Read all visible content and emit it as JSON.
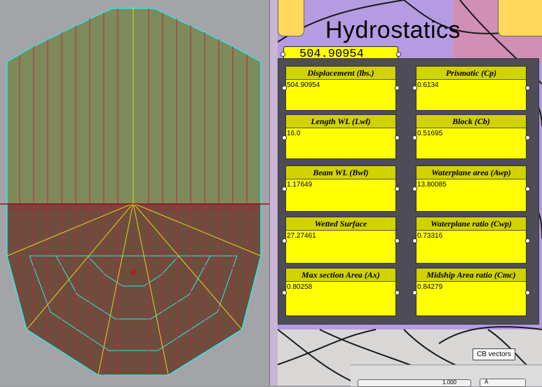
{
  "canvas": {
    "title": "Hydrostatics",
    "main_value": "504.90954"
  },
  "results": [
    {
      "label": "Displacement (lbs.)",
      "value": "504.90954"
    },
    {
      "label": "Prismatic (Cp)",
      "value": "0.6134"
    },
    {
      "label": "Length WL (Lwl)",
      "value": "16.0"
    },
    {
      "label": "Block (Cb)",
      "value": "0.51695"
    },
    {
      "label": "Beam WL (Bwl)",
      "value": "1.17649"
    },
    {
      "label": "Waterplane area (Awp)",
      "value": "13.80085"
    },
    {
      "label": "Wetted Surface",
      "value": "27.27461"
    },
    {
      "label": "Waterplane ratio (Cwp)",
      "value": "0.73316"
    },
    {
      "label": "Max section Area (Ax)",
      "value": "0.80258"
    },
    {
      "label": "Midship Area ratio (Cmc)",
      "value": "0.84279"
    }
  ],
  "tooltip": "CB vectors",
  "slider": {
    "value": "1.000"
  },
  "toggle": {
    "label": "A"
  },
  "colors": {
    "panel_bg": "#4e4c56",
    "card_fill": "#ffff00",
    "card_header": "#d2d200",
    "canvas_bg": "#b59ce2",
    "hull_above": "#7b8a55",
    "hull_below": "#6e4d3c",
    "waterline": "#8a1a1a"
  }
}
